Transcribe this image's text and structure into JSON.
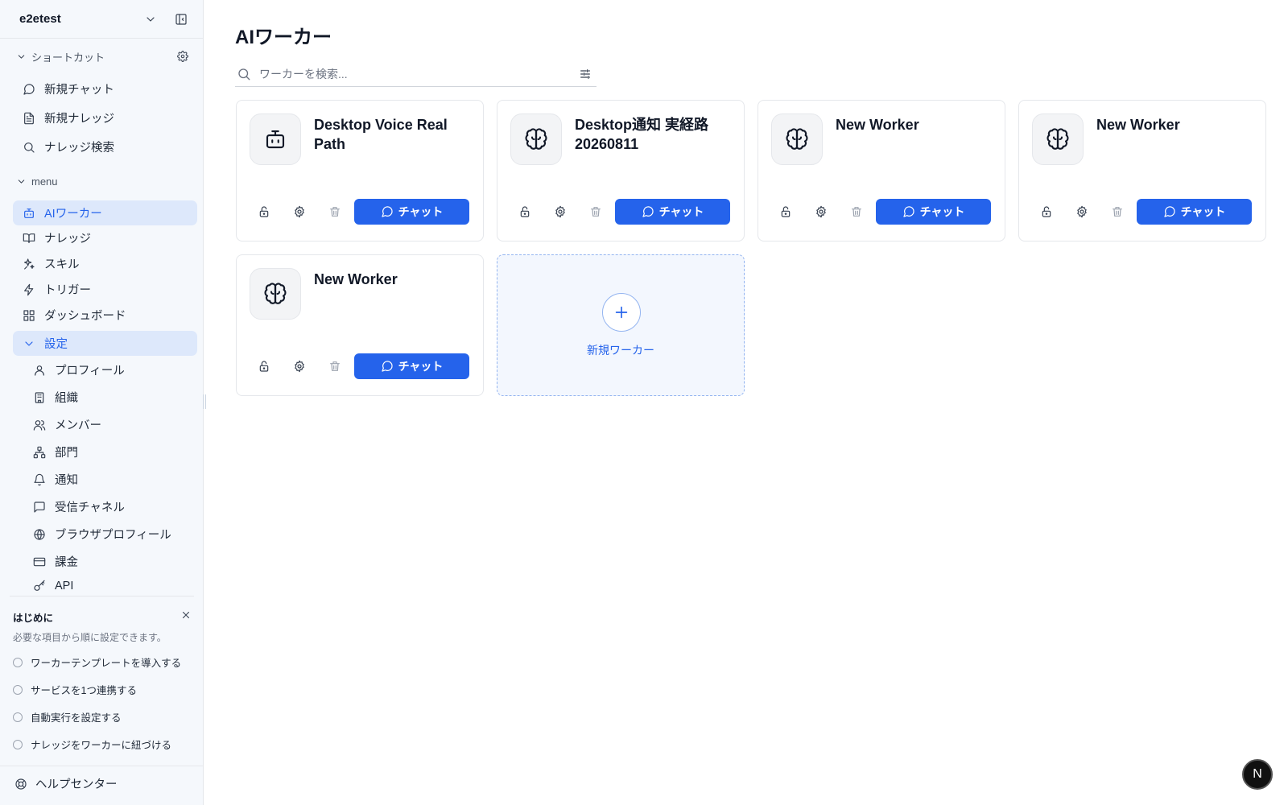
{
  "workspace": {
    "name": "e2etest"
  },
  "shortcuts": {
    "label": "ショートカット",
    "items": [
      {
        "label": "新規チャット",
        "icon": "chat-bubble-icon"
      },
      {
        "label": "新規ナレッジ",
        "icon": "document-icon"
      },
      {
        "label": "ナレッジ検索",
        "icon": "search-icon"
      }
    ]
  },
  "menu": {
    "label": "menu",
    "items": [
      {
        "label": "AIワーカー",
        "icon": "bot-icon",
        "active": true
      },
      {
        "label": "ナレッジ",
        "icon": "book-icon"
      },
      {
        "label": "スキル",
        "icon": "sparkles-icon"
      },
      {
        "label": "トリガー",
        "icon": "bolt-icon"
      },
      {
        "label": "ダッシュボード",
        "icon": "dashboard-icon"
      }
    ],
    "settings": {
      "label": "設定",
      "expanded": true,
      "items": [
        {
          "label": "プロフィール",
          "icon": "user-icon"
        },
        {
          "label": "組織",
          "icon": "building-icon"
        },
        {
          "label": "メンバー",
          "icon": "users-icon"
        },
        {
          "label": "部門",
          "icon": "org-chart-icon"
        },
        {
          "label": "通知",
          "icon": "bell-icon"
        },
        {
          "label": "受信チャネル",
          "icon": "message-square-icon"
        },
        {
          "label": "ブラウザプロフィール",
          "icon": "globe-icon"
        },
        {
          "label": "課金",
          "icon": "credit-card-icon"
        },
        {
          "label": "API",
          "icon": "key-icon"
        }
      ]
    }
  },
  "onboarding": {
    "title": "はじめに",
    "subtitle": "必要な項目から順に設定できます。",
    "steps": [
      {
        "label": "ワーカーテンプレートを導入する",
        "done": false
      },
      {
        "label": "サービスを1つ連携する",
        "done": false
      },
      {
        "label": "自動実行を設定する",
        "done": false
      },
      {
        "label": "ナレッジをワーカーに紐づける",
        "done": false
      }
    ]
  },
  "help": {
    "label": "ヘルプセンター"
  },
  "main": {
    "title": "AIワーカー",
    "search": {
      "placeholder": "ワーカーを検索...",
      "value": ""
    },
    "chat_label": "チャット",
    "workers": [
      {
        "name": "Desktop Voice Real Path",
        "icon": "bot-icon"
      },
      {
        "name": "Desktop通知 実経路 20260811",
        "icon": "brain-icon"
      },
      {
        "name": "New Worker",
        "icon": "brain-icon"
      },
      {
        "name": "New Worker",
        "icon": "brain-icon"
      },
      {
        "name": "New Worker",
        "icon": "brain-icon"
      }
    ],
    "new_worker_label": "新規ワーカー"
  },
  "fab": {
    "label": "N"
  },
  "colors": {
    "accent": "#2563eb",
    "sidebar_bg": "#f5f8fc",
    "active_bg": "#dde8fb"
  }
}
